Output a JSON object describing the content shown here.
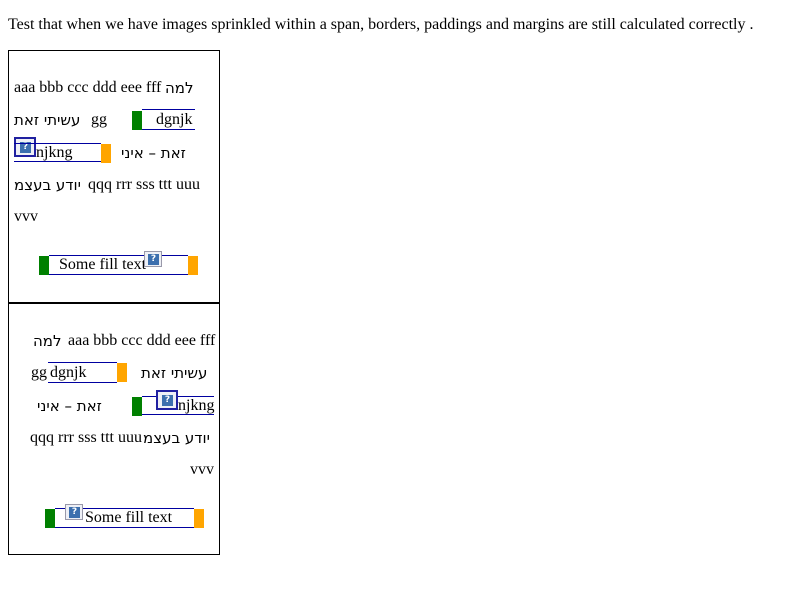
{
  "intro_text": "Test that when we have images sprinkled within a span, borders, paddings and margins are still calculated correctly .",
  "image_icon": "broken-image-icon",
  "colors": {
    "start_bar": "#008000",
    "end_bar": "#ffa500",
    "span_border": "#0000a0"
  },
  "box1": {
    "line1_latin": "aaa bbb ccc ddd eee fff",
    "line1_hebrew": "למה",
    "line2_hebrew": "עשיתי זאת",
    "line2_latin": "gg",
    "span_word1": "dgnjk",
    "span_word2": "njkng",
    "line3_hebrew": "זאת – איני",
    "line4_hebrew": "יודע בעצמ",
    "line4_latin": "qqq rrr sss ttt uuu",
    "line5": "vvv",
    "fill_text": "Some fill text"
  },
  "box2": {
    "line1_hebrew": "למה",
    "line1_latin": "aaa bbb ccc ddd eee fff",
    "line2_latin": "gg",
    "span_word1": "dgnjk",
    "line2_hebrew": "עשיתי זאת",
    "line3_hebrew": "זאת – איני",
    "span_word2": "njkng",
    "line4_latin": "qqq rrr sss ttt uuu",
    "line4_hebrew": "יודע בעצמ",
    "line5": "vvv",
    "fill_text": "Some fill text"
  }
}
